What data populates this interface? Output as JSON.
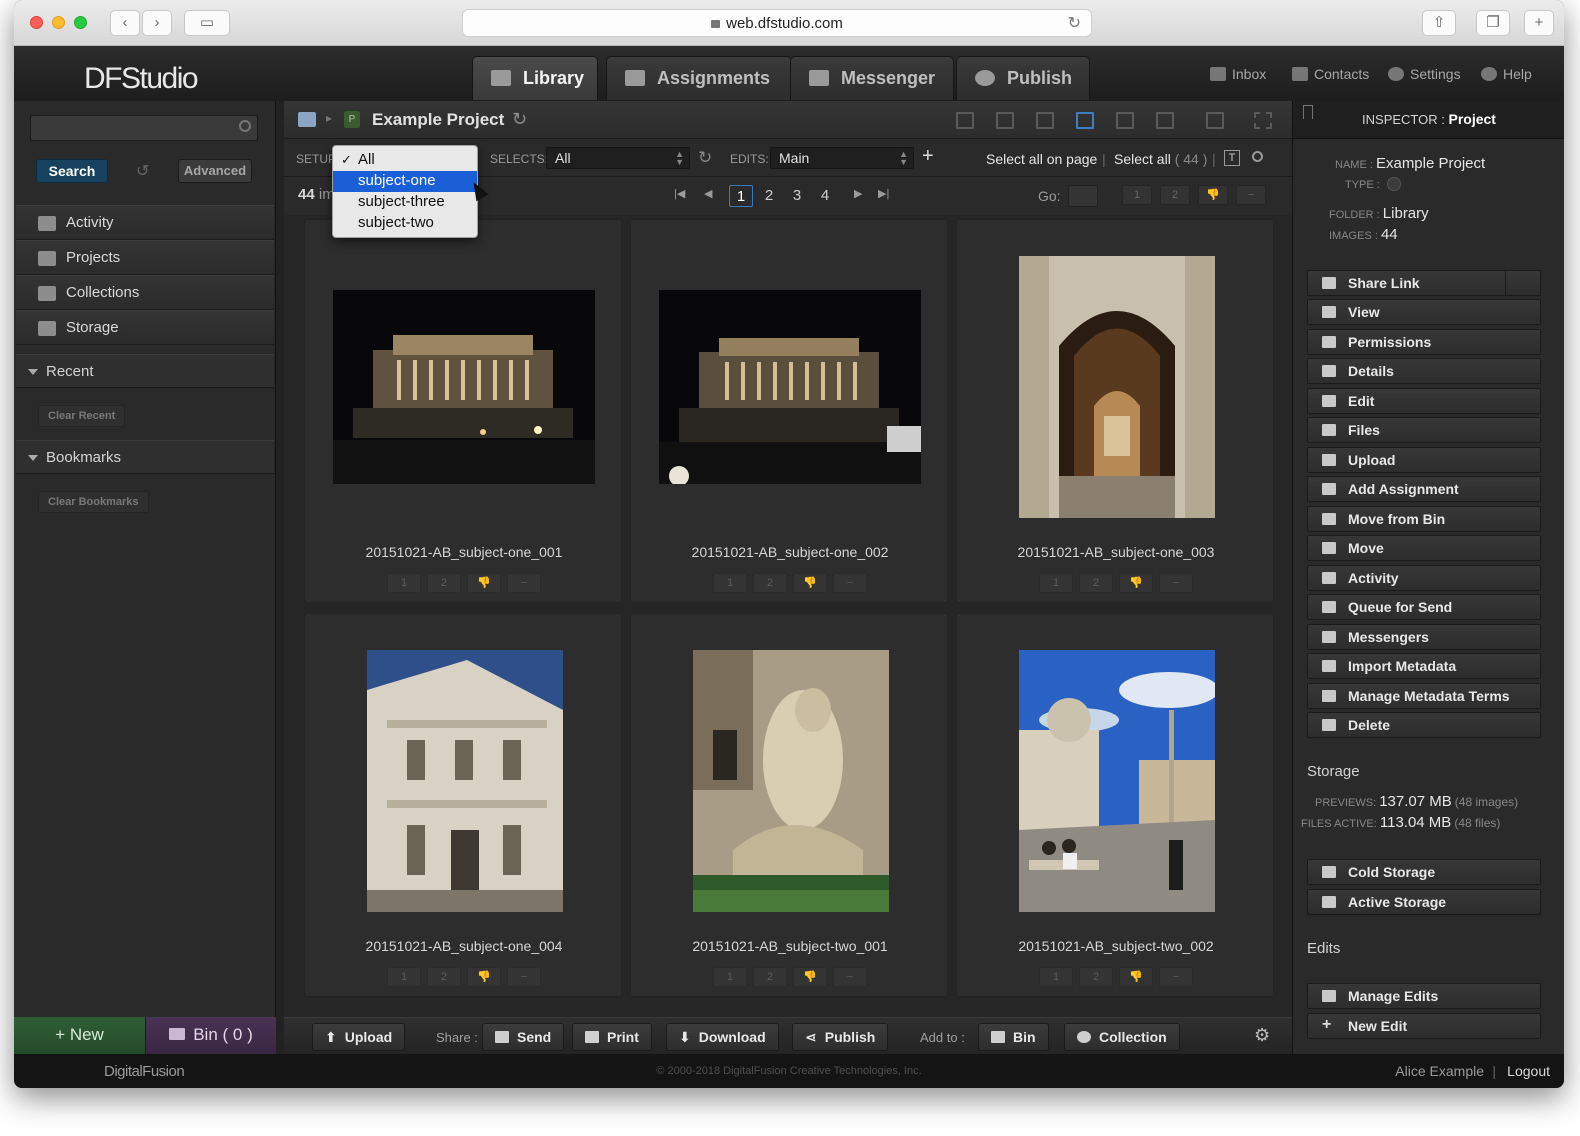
{
  "browser": {
    "url": "web.dfstudio.com"
  },
  "app": {
    "logo": "DFStudio",
    "tabs": [
      "Library",
      "Assignments",
      "Messenger",
      "Publish"
    ],
    "header_links": [
      "Inbox",
      "Contacts",
      "Settings",
      "Help"
    ]
  },
  "sidebar": {
    "search_label": "Search",
    "advanced_label": "Advanced",
    "nav": [
      "Activity",
      "Projects",
      "Collections",
      "Storage"
    ],
    "recent": {
      "title": "Recent",
      "clear": "Clear Recent"
    },
    "bookmarks": {
      "title": "Bookmarks",
      "clear": "Clear Bookmarks"
    },
    "new_label": "New",
    "bin_label": "Bin",
    "bin_count": "( 0 )"
  },
  "main": {
    "project_title": "Example Project",
    "filter": {
      "setup_label": "SETUP",
      "selects_label": "SELECTS:",
      "selects_value": "All",
      "edits_label": "EDITS:",
      "edits_value": "Main",
      "select_all_on_page": "Select all on page",
      "select_all": "Select all",
      "select_all_count": "( 44 )"
    },
    "image_count": "44",
    "image_count_suffix": "im",
    "pages": [
      "1",
      "2",
      "3",
      "4"
    ],
    "current_page": "1",
    "go_label": "Go:",
    "rate_labels": [
      "1",
      "2",
      "👎",
      "−"
    ],
    "photos": [
      {
        "caption": "20151021-AB_subject-one_001"
      },
      {
        "caption": "20151021-AB_subject-one_002"
      },
      {
        "caption": "20151021-AB_subject-one_003"
      },
      {
        "caption": "20151021-AB_subject-one_004"
      },
      {
        "caption": "20151021-AB_subject-two_001"
      },
      {
        "caption": "20151021-AB_subject-two_002"
      }
    ],
    "dropdown": {
      "options": [
        "All",
        "subject-one",
        "subject-three",
        "subject-two"
      ],
      "checked": "All",
      "highlighted": "subject-one"
    }
  },
  "bottombar": {
    "upload": "Upload",
    "share_label": "Share :",
    "send": "Send",
    "print": "Print",
    "download": "Download",
    "publish": "Publish",
    "addto_label": "Add to :",
    "bin": "Bin",
    "collection": "Collection"
  },
  "inspector": {
    "header_prefix": "INSPECTOR :",
    "header_value": "Project",
    "name_label": "NAME :",
    "name_value": "Example Project",
    "type_label": "TYPE :",
    "folder_label": "FOLDER :",
    "folder_value": "Library",
    "images_label": "IMAGES :",
    "images_value": "44",
    "actions": [
      "Share Link",
      "View",
      "Permissions",
      "Details",
      "Edit",
      "Files",
      "Upload",
      "Add Assignment",
      "Move from Bin",
      "Move",
      "Activity",
      "Queue for Send",
      "Messengers",
      "Import Metadata",
      "Manage Metadata Terms",
      "Delete"
    ],
    "storage": {
      "title": "Storage",
      "previews_label": "PREVIEWS:",
      "previews_value": "137.07 MB",
      "previews_note": "(48 images)",
      "files_label": "FILES ACTIVE:",
      "files_value": "113.04 MB",
      "files_note": "(48 files)",
      "actions": [
        "Cold Storage",
        "Active Storage"
      ]
    },
    "edits": {
      "title": "Edits",
      "actions": [
        "Manage Edits",
        "New Edit"
      ]
    }
  },
  "footer": {
    "brand": "DigitalFusion",
    "copyright": "© 2000-2018 DigitalFusion Creative Technologies, Inc.",
    "user": "Alice Example",
    "logout": "Logout"
  }
}
